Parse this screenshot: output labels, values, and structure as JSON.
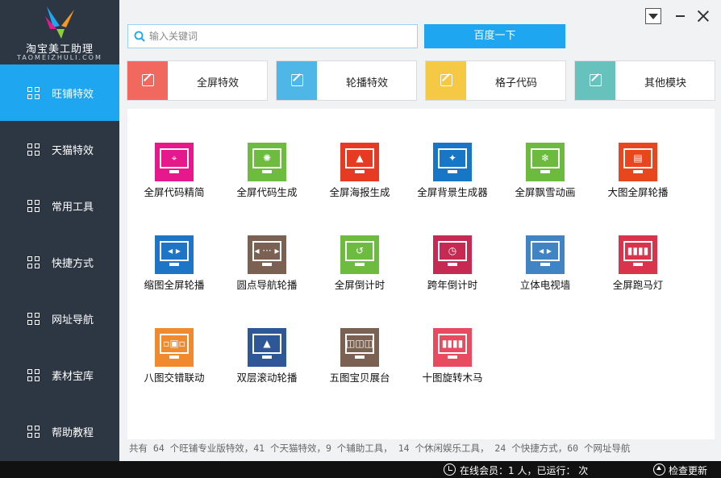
{
  "app": {
    "title": "淘宝美工助理",
    "subtitle": "TAOMEIZHULI.COM"
  },
  "sidebar": {
    "items": [
      {
        "label": "旺铺特效",
        "active": true
      },
      {
        "label": "天猫特效",
        "active": false
      },
      {
        "label": "常用工具",
        "active": false
      },
      {
        "label": "快捷方式",
        "active": false
      },
      {
        "label": "网址导航",
        "active": false
      },
      {
        "label": "素材宝库",
        "active": false
      },
      {
        "label": "帮助教程",
        "active": false
      }
    ]
  },
  "search": {
    "placeholder": "输入关键词",
    "button_label": "百度一下"
  },
  "categories": [
    {
      "label": "全屏特效",
      "color": "#f1685e"
    },
    {
      "label": "轮播特效",
      "color": "#4fb6e8"
    },
    {
      "label": "格子代码",
      "color": "#f6c944"
    },
    {
      "label": "其他模块",
      "color": "#67c2bd"
    }
  ],
  "tools": [
    {
      "label": "全屏代码精简",
      "color": "#e5198b",
      "icon": "crosshair-icon",
      "glyph": "⌖"
    },
    {
      "label": "全屏代码生成",
      "color": "#6dbb3f",
      "icon": "spinner-icon",
      "glyph": "✺"
    },
    {
      "label": "全屏海报生成",
      "color": "#e63a22",
      "icon": "mountain-icon",
      "glyph": "▲"
    },
    {
      "label": "全屏背景生成器",
      "color": "#1776c6",
      "icon": "pin-icon",
      "glyph": "✦"
    },
    {
      "label": "全屏飘雪动画",
      "color": "#6cbb3e",
      "icon": "snowflake-icon",
      "glyph": "❄"
    },
    {
      "label": "大图全屏轮播",
      "color": "#e8461d",
      "icon": "slides-icon",
      "glyph": "▤"
    },
    {
      "label": "缩图全屏轮播",
      "color": "#1e74c5",
      "icon": "slider-icon",
      "glyph": "◂ ▸"
    },
    {
      "label": "圆点导航轮播",
      "color": "#7a6151",
      "icon": "dots-icon",
      "glyph": "◂ ··· ▸"
    },
    {
      "label": "全屏倒计时",
      "color": "#6dbb3f",
      "icon": "history-icon",
      "glyph": "↺"
    },
    {
      "label": "跨年倒计时",
      "color": "#c62a52",
      "icon": "clock-icon",
      "glyph": "◷"
    },
    {
      "label": "立体电视墙",
      "color": "#4184c4",
      "icon": "arrows-icon",
      "glyph": "◂ ▸"
    },
    {
      "label": "全屏跑马灯",
      "color": "#d9344b",
      "icon": "filmstrip-icon",
      "glyph": "▮▮▮▮"
    },
    {
      "label": "八图交错联动",
      "color": "#ef8a2f",
      "icon": "gallery-icon",
      "glyph": "▫▣▫"
    },
    {
      "label": "双层滚动轮播",
      "color": "#2e5797",
      "icon": "landscape-icon",
      "glyph": "▲"
    },
    {
      "label": "五图宝贝展台",
      "color": "#7a6151",
      "icon": "showcase-icon",
      "glyph": "◫◫◫"
    },
    {
      "label": "十图旋转木马",
      "color": "#e84a5f",
      "icon": "carousel-icon",
      "glyph": "▮▮▮▮"
    }
  ],
  "summary": "共有 64 个旺铺专业版特效，41 个天猫特效，9 个辅助工具， 14 个休闲娱乐工具， 24 个快捷方式，60 个网址导航",
  "status": {
    "online_text": "在线会员：1 人，已运行：  次",
    "update_label": "检查更新"
  }
}
